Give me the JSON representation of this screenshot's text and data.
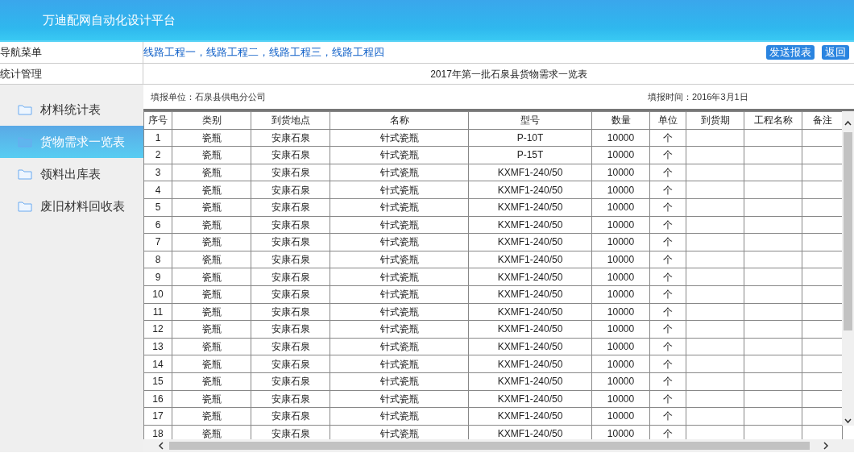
{
  "app_title": "万迪配网自动化设计平台",
  "nav_label": "导航菜单",
  "project_links": "线路工程一，线路工程二，线路工程三，线路工程四",
  "buttons": [
    "发送报表",
    "返回"
  ],
  "section_label": "统计管理",
  "sidebar": {
    "items": [
      {
        "label": "材料统计表",
        "selected": false
      },
      {
        "label": "货物需求一览表",
        "selected": true
      },
      {
        "label": "领料出库表",
        "selected": false
      },
      {
        "label": "废旧材料回收表",
        "selected": false
      }
    ]
  },
  "report": {
    "title": "2017年第一批石泉县货物需求一览表",
    "unit": "填报单位：石泉县供电分公司",
    "date": "填报时间：2016年3月1日"
  },
  "table": {
    "columns": [
      "序号",
      "类别",
      "到货地点",
      "名称",
      "型号",
      "数量",
      "单位",
      "到货期",
      "工程名称",
      "备注"
    ],
    "rows": [
      {
        "no": "1",
        "category": "瓷瓶",
        "place": "安康石泉",
        "name": "针式瓷瓶",
        "model": "P-10T",
        "qty": "10000",
        "unit": "个"
      },
      {
        "no": "2",
        "category": "瓷瓶",
        "place": "安康石泉",
        "name": "针式瓷瓶",
        "model": "P-15T",
        "qty": "10000",
        "unit": "个"
      },
      {
        "no": "3",
        "category": "瓷瓶",
        "place": "安康石泉",
        "name": "针式瓷瓶",
        "model": "KXMF1-240/50",
        "qty": "10000",
        "unit": "个"
      },
      {
        "no": "4",
        "category": "瓷瓶",
        "place": "安康石泉",
        "name": "针式瓷瓶",
        "model": "KXMF1-240/50",
        "qty": "10000",
        "unit": "个"
      },
      {
        "no": "5",
        "category": "瓷瓶",
        "place": "安康石泉",
        "name": "针式瓷瓶",
        "model": "KXMF1-240/50",
        "qty": "10000",
        "unit": "个"
      },
      {
        "no": "6",
        "category": "瓷瓶",
        "place": "安康石泉",
        "name": "针式瓷瓶",
        "model": "KXMF1-240/50",
        "qty": "10000",
        "unit": "个"
      },
      {
        "no": "7",
        "category": "瓷瓶",
        "place": "安康石泉",
        "name": "针式瓷瓶",
        "model": "KXMF1-240/50",
        "qty": "10000",
        "unit": "个"
      },
      {
        "no": "8",
        "category": "瓷瓶",
        "place": "安康石泉",
        "name": "针式瓷瓶",
        "model": "KXMF1-240/50",
        "qty": "10000",
        "unit": "个"
      },
      {
        "no": "9",
        "category": "瓷瓶",
        "place": "安康石泉",
        "name": "针式瓷瓶",
        "model": "KXMF1-240/50",
        "qty": "10000",
        "unit": "个"
      },
      {
        "no": "10",
        "category": "瓷瓶",
        "place": "安康石泉",
        "name": "针式瓷瓶",
        "model": "KXMF1-240/50",
        "qty": "10000",
        "unit": "个"
      },
      {
        "no": "11",
        "category": "瓷瓶",
        "place": "安康石泉",
        "name": "针式瓷瓶",
        "model": "KXMF1-240/50",
        "qty": "10000",
        "unit": "个"
      },
      {
        "no": "12",
        "category": "瓷瓶",
        "place": "安康石泉",
        "name": "针式瓷瓶",
        "model": "KXMF1-240/50",
        "qty": "10000",
        "unit": "个"
      },
      {
        "no": "13",
        "category": "瓷瓶",
        "place": "安康石泉",
        "name": "针式瓷瓶",
        "model": "KXMF1-240/50",
        "qty": "10000",
        "unit": "个"
      },
      {
        "no": "14",
        "category": "瓷瓶",
        "place": "安康石泉",
        "name": "针式瓷瓶",
        "model": "KXMF1-240/50",
        "qty": "10000",
        "unit": "个"
      },
      {
        "no": "15",
        "category": "瓷瓶",
        "place": "安康石泉",
        "name": "针式瓷瓶",
        "model": "KXMF1-240/50",
        "qty": "10000",
        "unit": "个"
      },
      {
        "no": "16",
        "category": "瓷瓶",
        "place": "安康石泉",
        "name": "针式瓷瓶",
        "model": "KXMF1-240/50",
        "qty": "10000",
        "unit": "个"
      },
      {
        "no": "17",
        "category": "瓷瓶",
        "place": "安康石泉",
        "name": "针式瓷瓶",
        "model": "KXMF1-240/50",
        "qty": "10000",
        "unit": "个"
      },
      {
        "no": "18",
        "category": "瓷瓶",
        "place": "安康石泉",
        "name": "针式瓷瓶",
        "model": "KXMF1-240/50",
        "qty": "10000",
        "unit": "个"
      }
    ]
  }
}
